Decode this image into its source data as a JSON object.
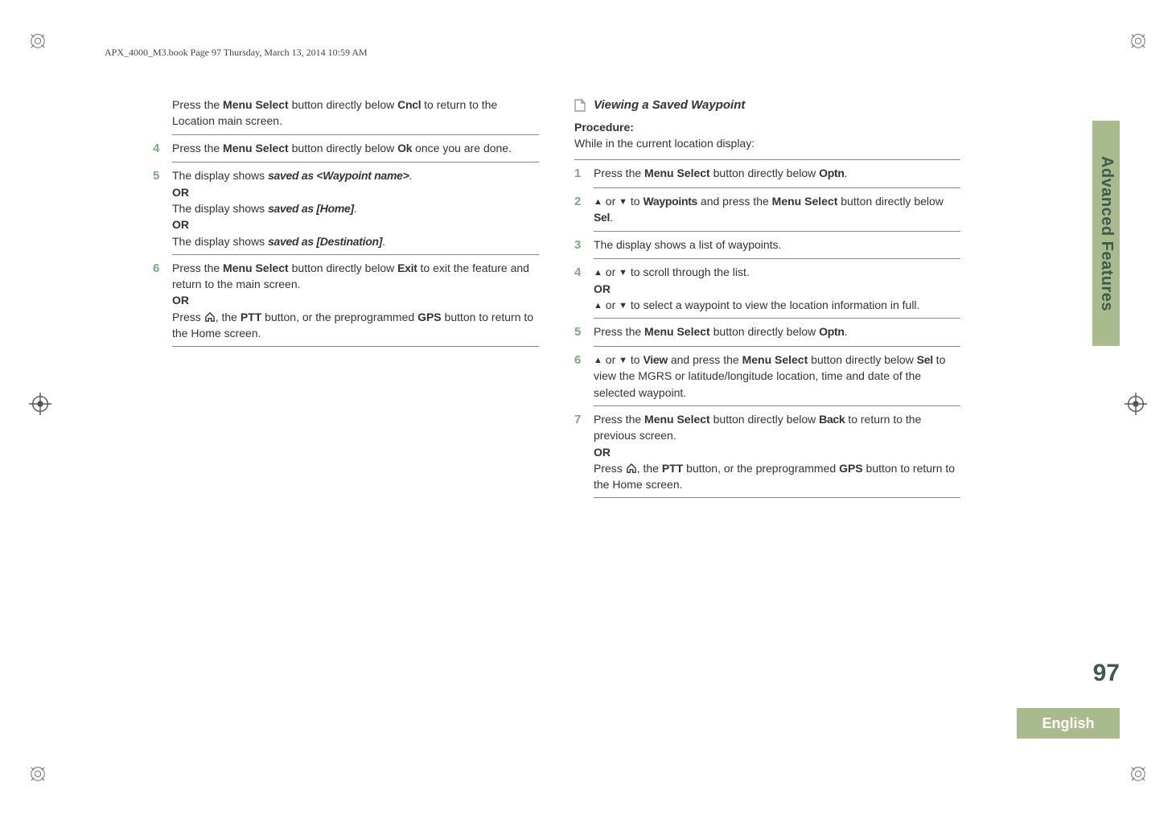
{
  "book_header": "APX_4000_M3.book  Page 97  Thursday, March 13, 2014  10:59 AM",
  "side_tab": "Advanced Features",
  "page_number": "97",
  "language": "English",
  "left": {
    "resume": "Press the <b>Menu Select</b> button directly below <ui>Cncl</ui> to return to the Location main screen.",
    "s4": "Press the <b>Menu Select</b> button directly below <ui>Ok</ui> once you are done.",
    "s5a": "The display shows <uii>saved as &lt;Waypoint name&gt;</uii>.",
    "s5_or1": "OR",
    "s5b": "The display shows <uii>saved as [Home]</uii>.",
    "s5_or2": "OR",
    "s5c": "The display shows <uii>saved as [Destination]</uii>.",
    "s6a": "Press the <b>Menu Select</b> button directly below <ui>Exit</ui> to exit the feature and return to the main screen.",
    "s6_or": "OR",
    "s6b_pre": "Press ",
    "s6b_post": ", the <b>PTT</b> button, or the preprogrammed <b>GPS</b> button to return to the Home screen."
  },
  "right": {
    "section_title": "Viewing a Saved Waypoint",
    "proc_label": "Procedure:",
    "proc_intro": "While in the current location display:",
    "s1": "Press the <b>Menu Select</b> button directly below <ui>Optn</ui>.",
    "s2_pre": "",
    "s2_mid1": " or ",
    "s2_mid2": " to <ui>Waypoints</ui> and press the <b>Menu Select</b> button directly below <ui>Sel</ui>.",
    "s3": "The display shows a list of waypoints.",
    "s4a_pre": "",
    "s4a_mid": " or ",
    "s4a_post": " to scroll through the list.",
    "s4_or": "OR",
    "s4b_pre": "",
    "s4b_mid": " or ",
    "s4b_post": " to select a waypoint to view the location information in full.",
    "s5": "Press the <b>Menu Select</b> button directly below <ui>Optn</ui>.",
    "s6_pre": "",
    "s6_mid": " or ",
    "s6_post": " to <ui>View</ui> and press the <b>Menu Select</b> button directly below <ui>Sel</ui> to view the MGRS or latitude/longitude location, time and date of the selected waypoint.",
    "s7a": "Press the <b>Menu Select</b> button directly below <ui>Back</ui> to return to the previous screen.",
    "s7_or": "OR",
    "s7b_pre": "Press ",
    "s7b_post": ", the <b>PTT</b> button, or the preprogrammed <b>GPS</b> button to return to the Home screen."
  },
  "step_nums": {
    "l4": "4",
    "l5": "5",
    "l6": "6",
    "r1": "1",
    "r2": "2",
    "r3": "3",
    "r4": "4",
    "r5": "5",
    "r6": "6",
    "r7": "7"
  }
}
